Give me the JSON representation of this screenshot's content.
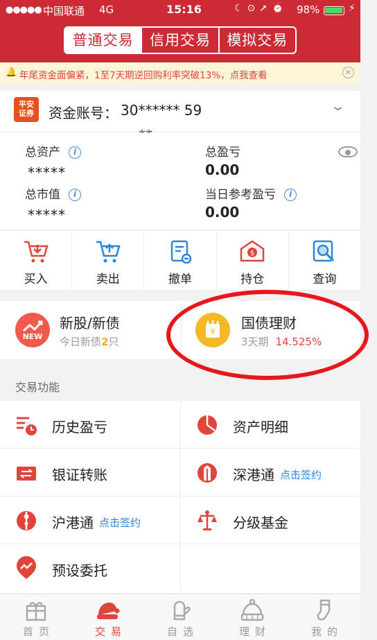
{
  "status_bar": {
    "signal": "●●●●●",
    "carrier": "中国联通",
    "network": "4G",
    "time": "15:16",
    "battery": "98%"
  },
  "header": {
    "tabs": [
      "普通交易",
      "信用交易",
      "模拟交易"
    ],
    "active_tab": 0
  },
  "notice": {
    "text": "年尾资金面偏紧，1至7天期逆回购利率突破13%，点我查看"
  },
  "account": {
    "logo_text": "平安证券",
    "label": "资金账号：",
    "number": "30****** 59",
    "extra": "**"
  },
  "assets": {
    "total_assets_label": "总资产",
    "total_assets_value": "*****",
    "total_pl_label": "总盈亏",
    "total_pl_value": "0.00",
    "market_value_label": "总市值",
    "market_value_value": "*****",
    "day_pl_label": "当日参考盈亏",
    "day_pl_value": "0.00"
  },
  "actions": [
    {
      "label": "买入",
      "icon": "buy-cart-icon"
    },
    {
      "label": "卖出",
      "icon": "sell-cart-icon"
    },
    {
      "label": "撤单",
      "icon": "cancel-order-icon"
    },
    {
      "label": "持仓",
      "icon": "holdings-icon"
    },
    {
      "label": "查询",
      "icon": "search-icon"
    }
  ],
  "cards": {
    "ipo": {
      "title": "新股/新债",
      "sub_prefix": "今日新债",
      "count": "2",
      "sub_suffix": "只",
      "badge": "NEW"
    },
    "bond": {
      "title": "国债理财",
      "period": "3天期",
      "rate": "14.525%"
    }
  },
  "section": {
    "title": "交易功能"
  },
  "functions": [
    {
      "label": "历史盈亏",
      "sign": "",
      "icon": "history-pl-icon"
    },
    {
      "label": "资产明细",
      "sign": "",
      "icon": "pie-chart-icon"
    },
    {
      "label": "银证转账",
      "sign": "",
      "icon": "transfer-icon"
    },
    {
      "label": "深港通",
      "sign": "点击签约",
      "icon": "shenzhen-hk-icon"
    },
    {
      "label": "沪港通",
      "sign": "点击签约",
      "icon": "shanghai-hk-icon"
    },
    {
      "label": "分级基金",
      "sign": "",
      "icon": "graded-fund-icon"
    },
    {
      "label": "预设委托",
      "sign": "",
      "icon": "preset-order-icon"
    }
  ],
  "tabbar": [
    {
      "label": "首页",
      "icon": "gift-icon"
    },
    {
      "label": "交易",
      "icon": "hat-icon",
      "active": true
    },
    {
      "label": "自选",
      "icon": "glove-icon"
    },
    {
      "label": "理财",
      "icon": "beanie-icon"
    },
    {
      "label": "我的",
      "icon": "sock-icon"
    }
  ],
  "colors": {
    "brand_red": "#cc2b36",
    "accent_red": "#e0443b",
    "link_blue": "#2a86d8",
    "orange": "#f5a623"
  }
}
